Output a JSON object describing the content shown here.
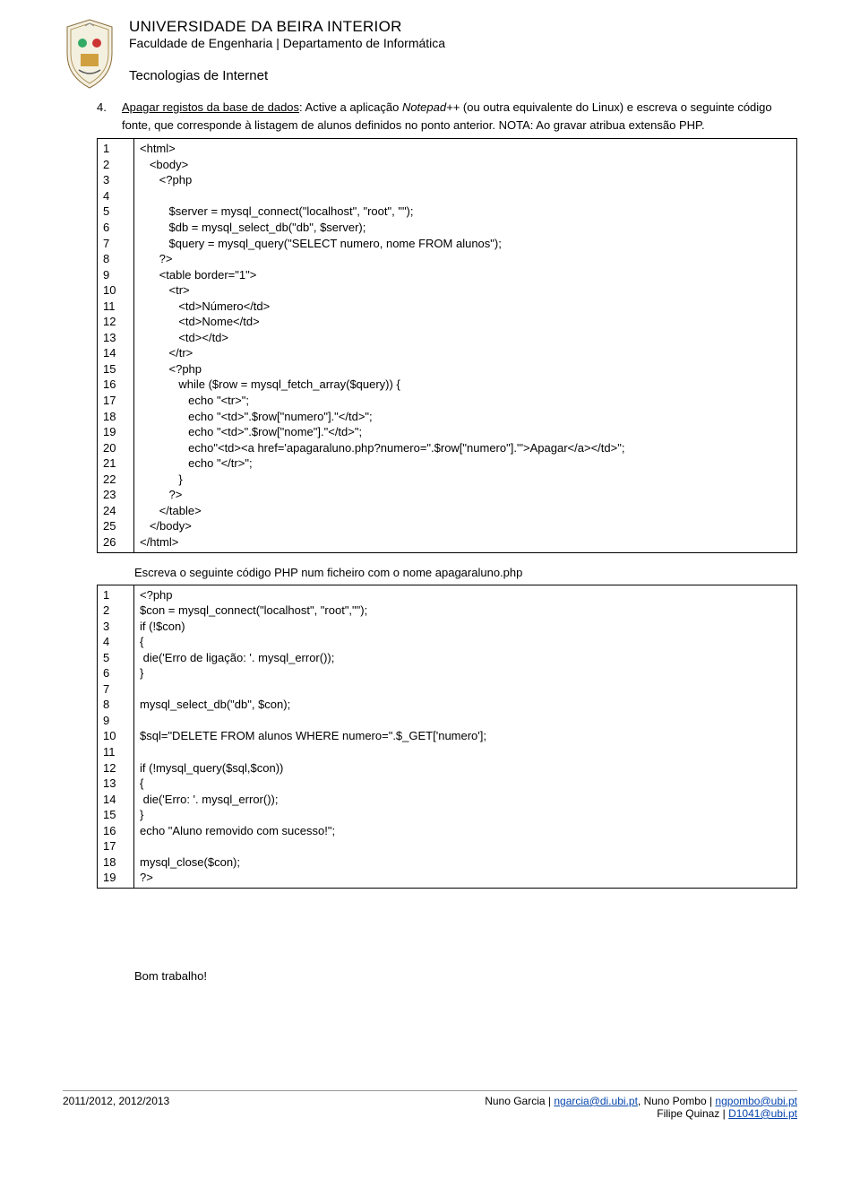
{
  "header": {
    "line1": "UNIVERSIDADE DA BEIRA INTERIOR",
    "line2": "Faculdade de Engenharia | Departamento de Informática",
    "line3": "Tecnologias de Internet"
  },
  "item": {
    "number": "4.",
    "text_before_underline": "Apagar registos da base de dados",
    "text_after_underline": ": Active a aplicação ",
    "notepad": "Notepad++",
    "text_cont": " (ou outra equivalente do Linux) e escreva o seguinte código fonte, que corresponde à listagem de alunos definidos no ponto anterior. NOTA: Ao gravar atribua extensão PHP."
  },
  "code1_lines": [
    "1",
    "2",
    "3",
    "4",
    "5",
    "6",
    "7",
    "8",
    "9",
    "10",
    "11",
    "12",
    "13",
    "14",
    "15",
    "16",
    "17",
    "18",
    "19",
    "20",
    "21",
    "22",
    "23",
    "24",
    "25",
    "26"
  ],
  "code1": [
    "<html>",
    "   <body>",
    "      <?php",
    "",
    "         $server = mysql_connect(\"localhost\", \"root\", \"\");",
    "         $db = mysql_select_db(\"db\", $server);",
    "         $query = mysql_query(\"SELECT numero, nome FROM alunos\");",
    "      ?>",
    "      <table border=\"1\">",
    "         <tr>",
    "            <td>Número</td>",
    "            <td>Nome</td>",
    "            <td></td>",
    "         </tr>",
    "         <?php",
    "            while ($row = mysql_fetch_array($query)) {",
    "               echo \"<tr>\";",
    "               echo \"<td>\".$row[\"numero\"].\"</td>\";",
    "               echo \"<td>\".$row[\"nome\"].\"</td>\";",
    "               echo\"<td><a href='apagaraluno.php?numero=\".$row[\"numero\"].\"'>Apagar</a></td>\";",
    "               echo \"</tr>\";",
    "            }",
    "         ?>",
    "      </table>",
    "   </body>",
    "</html>"
  ],
  "mid_label": "Escreva o seguinte código PHP num ficheiro com o nome apagaraluno.php",
  "code2_lines": [
    "1",
    "2",
    "3",
    "4",
    "5",
    "6",
    "7",
    "8",
    "9",
    "10",
    "11",
    "12",
    "13",
    "14",
    "15",
    "16",
    "17",
    "18",
    "19"
  ],
  "code2": [
    "<?php",
    "$con = mysql_connect(\"localhost\", \"root\",\"\");",
    "if (!$con)",
    "{",
    " die('Erro de ligação: '. mysql_error());",
    "}",
    "",
    "mysql_select_db(\"db\", $con);",
    "",
    "$sql=\"DELETE FROM alunos WHERE numero=\".$_GET['numero'];",
    "",
    "if (!mysql_query($sql,$con))",
    "{",
    " die('Erro: '. mysql_error());",
    "}",
    "echo \"Aluno removido com sucesso!\";",
    "",
    "mysql_close($con);",
    "?>"
  ],
  "closing": "Bom trabalho!",
  "footer": {
    "left": "2011/2012, 2012/2013",
    "r1a": "Nuno Garcia | ",
    "r1b": "ngarcia@di.ubi.pt",
    "r1c": ", Nuno Pombo | ",
    "r1d": "ngpombo@ubi.pt",
    "r2a": "Filipe Quinaz | ",
    "r2b": "D1041@ubi.pt"
  }
}
